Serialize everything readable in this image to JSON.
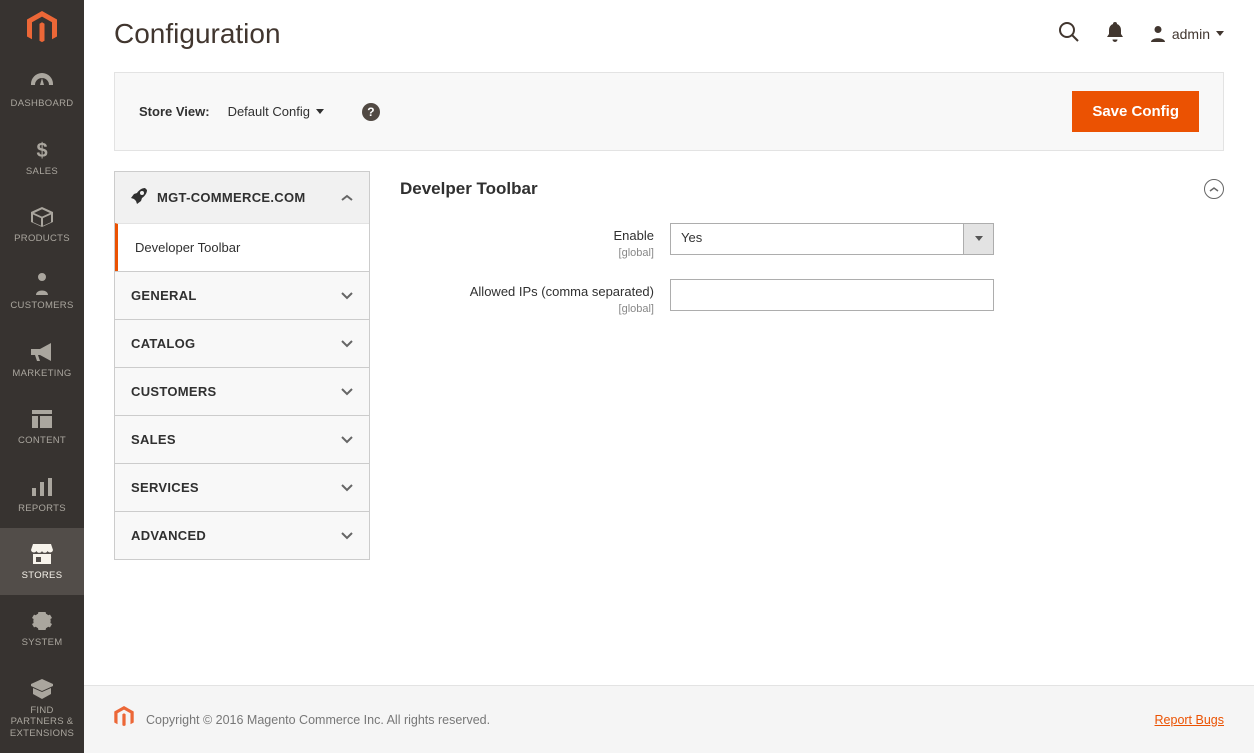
{
  "sidebar": {
    "items": [
      {
        "label": "DASHBOARD"
      },
      {
        "label": "SALES"
      },
      {
        "label": "PRODUCTS"
      },
      {
        "label": "CUSTOMERS"
      },
      {
        "label": "MARKETING"
      },
      {
        "label": "CONTENT"
      },
      {
        "label": "REPORTS"
      },
      {
        "label": "STORES"
      },
      {
        "label": "SYSTEM"
      },
      {
        "label": "FIND PARTNERS & EXTENSIONS"
      }
    ]
  },
  "header": {
    "page_title": "Configuration",
    "admin_label": "admin"
  },
  "toolbar": {
    "storeview_label": "Store View:",
    "storeview_value": "Default Config",
    "save_label": "Save Config"
  },
  "config_nav": {
    "brand_group": "MGT-COMMERCE.COM",
    "brand_subitem": "Developer Toolbar",
    "groups": [
      {
        "label": "GENERAL"
      },
      {
        "label": "CATALOG"
      },
      {
        "label": "CUSTOMERS"
      },
      {
        "label": "SALES"
      },
      {
        "label": "SERVICES"
      },
      {
        "label": "ADVANCED"
      }
    ]
  },
  "panel": {
    "title": "Develper Toolbar",
    "fields": {
      "enable": {
        "label": "Enable",
        "scope": "[global]",
        "value": "Yes"
      },
      "allowed_ips": {
        "label": "Allowed IPs (comma separated)",
        "scope": "[global]",
        "value": ""
      }
    }
  },
  "footer": {
    "copyright": "Copyright © 2016 Magento Commerce Inc. All rights reserved.",
    "report_link": "Report Bugs"
  }
}
